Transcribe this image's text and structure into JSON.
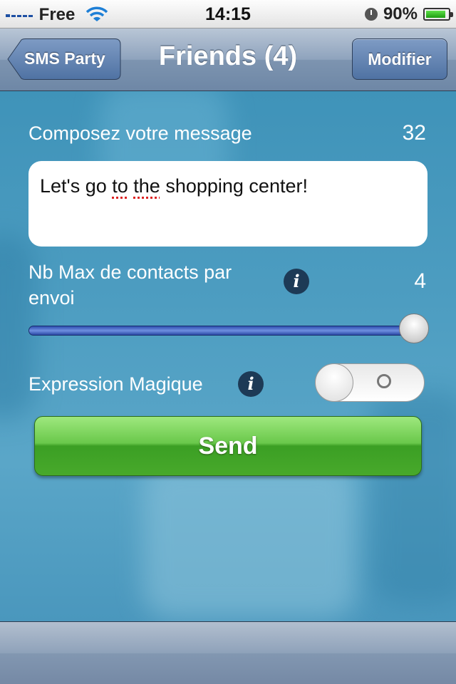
{
  "status_bar": {
    "carrier": "Free",
    "time": "14:15",
    "battery": "90%"
  },
  "navbar": {
    "back_label": "SMS Party",
    "title": "Friends (4)",
    "edit_label": "Modifier"
  },
  "compose": {
    "label": "Composez votre message",
    "counter": "32",
    "message_parts": [
      "Let's go ",
      "to",
      " ",
      "the",
      " shopping center!"
    ]
  },
  "contacts": {
    "label": "Nb Max de contacts par envoi",
    "value": "4",
    "slider_fraction": 1.0
  },
  "magic": {
    "label": "Expression Magique",
    "toggle_on": false
  },
  "actions": {
    "send_label": "Send"
  },
  "colors": {
    "send_green": "#4aa82d",
    "nav_blue": "#8ea3bd",
    "background": "#4d9dc1"
  },
  "icons": [
    "signal-icon",
    "wifi-icon",
    "clock-icon",
    "battery-icon",
    "info-icon"
  ]
}
